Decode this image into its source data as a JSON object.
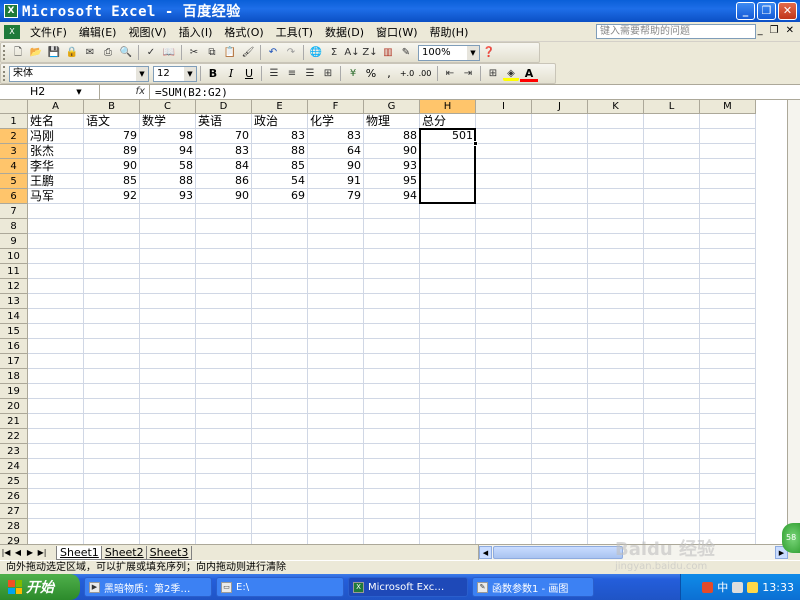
{
  "window": {
    "title": "Microsoft Excel - 百度经验",
    "app_icon": "X",
    "min": "_",
    "restore": "❐",
    "close": "✕"
  },
  "menu": {
    "items": [
      "文件(F)",
      "编辑(E)",
      "视图(V)",
      "插入(I)",
      "格式(O)",
      "工具(T)",
      "数据(D)",
      "窗口(W)",
      "帮助(H)"
    ],
    "help_placeholder": "键入需要帮助的问题",
    "right": [
      "▾",
      "_",
      "❐",
      "✕"
    ]
  },
  "toolbar": {
    "zoom": "100%",
    "font_name": "宋体",
    "font_size": "12",
    "bold": "B",
    "italic": "I",
    "underline": "U",
    "percent": "%",
    "comma": ",",
    "inc_decimal": "+.0",
    "dec_decimal": ".00",
    "sigma": "Σ",
    "fill_color": "#ffff00",
    "font_color": "#ff0000",
    "font_color_label": "A"
  },
  "formula_bar": {
    "name_box": "H2",
    "fx": "fx",
    "formula": "=SUM(B2:G2)"
  },
  "sheet": {
    "columns": [
      "A",
      "B",
      "C",
      "D",
      "E",
      "F",
      "G",
      "H",
      "I",
      "J",
      "K",
      "L",
      "M"
    ],
    "selected_column": "H",
    "row_numbers": [
      "1",
      "2",
      "3",
      "4",
      "5",
      "6",
      "7",
      "8",
      "9",
      "10",
      "11",
      "12",
      "13",
      "14",
      "15",
      "16",
      "17",
      "18",
      "19",
      "20",
      "21",
      "22",
      "23",
      "24",
      "25",
      "26",
      "27",
      "28",
      "29"
    ],
    "selected_rows": [
      "2",
      "3",
      "4",
      "5",
      "6"
    ],
    "header_row": [
      "姓名",
      "语文",
      "数学",
      "英语",
      "政治",
      "化学",
      "物理",
      "总分"
    ],
    "rows": [
      [
        "冯刚",
        "79",
        "98",
        "70",
        "83",
        "83",
        "88",
        "501"
      ],
      [
        "张杰",
        "89",
        "94",
        "83",
        "88",
        "64",
        "90",
        ""
      ],
      [
        "李华",
        "90",
        "58",
        "84",
        "85",
        "90",
        "93",
        ""
      ],
      [
        "王鹏",
        "85",
        "88",
        "86",
        "54",
        "91",
        "95",
        ""
      ],
      [
        "马军",
        "92",
        "93",
        "90",
        "69",
        "79",
        "94",
        ""
      ]
    ]
  },
  "tabs": {
    "nav": [
      "|◀",
      "◀",
      "▶",
      "▶|"
    ],
    "sheets": [
      "Sheet1",
      "Sheet2",
      "Sheet3"
    ],
    "active": "Sheet1"
  },
  "status": {
    "text": "向外拖动选定区域，可以扩展或填充序列；向内拖动则进行清除"
  },
  "taskbar": {
    "start": "开始",
    "items": [
      {
        "label": "黑暗物质：第2季…",
        "active": false
      },
      {
        "label": "E:\\",
        "active": false
      },
      {
        "label": "Microsoft Exc…",
        "active": true
      },
      {
        "label": "函数参数1 - 画图",
        "active": false
      }
    ],
    "clock": "13:33",
    "ime": "中"
  },
  "watermark": {
    "brand": "Baidu 经验",
    "url": "jingyan.baidu.com"
  },
  "bubble": "58"
}
